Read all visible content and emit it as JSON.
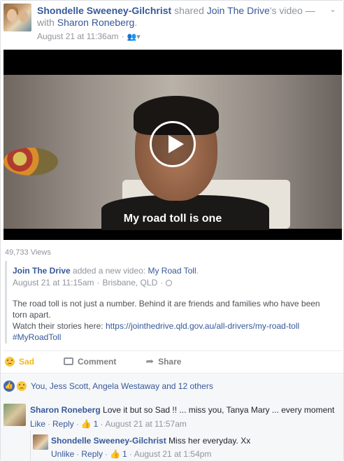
{
  "post": {
    "author": "Shondelle Sweeney-Gilchrist",
    "shared_text": "shared",
    "page_name": "Join The Drive",
    "video_suffix": "'s video —",
    "with_text": "with",
    "tagged": "Sharon Roneberg",
    "tagged_suffix": ".",
    "timestamp": "August 21 at 11:36am",
    "audience_icon": "friends-icon"
  },
  "video": {
    "caption": "My road toll is one",
    "views": "49,733 Views"
  },
  "shared": {
    "page_name": "Join The Drive",
    "added_text": "added a new video:",
    "video_title": "My Road Toll",
    "video_title_suffix": ".",
    "timestamp": "August 21 at 11:15am",
    "location": "Brisbane, QLD",
    "desc_line1": "The road toll is not just a number. Behind it are friends and families who have been torn apart.",
    "desc_line2_prefix": "Watch their stories here: ",
    "desc_link": "https://jointhedrive.qld.gov.au/all-drivers/my-road-toll",
    "hashtag": "#MyRoadToll"
  },
  "actions": {
    "sad_label": "Sad",
    "comment_label": "Comment",
    "share_label": "Share"
  },
  "reactions": {
    "summary": "You, Jess Scott, Angela Westaway and 12 others"
  },
  "comments": [
    {
      "author": "Sharon Roneberg",
      "text": "Love it but so Sad !! ... miss you, Tanya Mary ... every moment",
      "action1": "Like",
      "action2": "Reply",
      "likes": "1",
      "time": "August 21 at 11:57am"
    },
    {
      "author": "Shondelle Sweeney-Gilchrist",
      "text": "Miss her everyday. Xx",
      "action1": "Unlike",
      "action2": "Reply",
      "likes": "1",
      "time": "August 21 at 1:54pm"
    }
  ],
  "separators": {
    "dot": "·"
  },
  "colors": {
    "link": "#365899",
    "meta": "#90949c",
    "sad": "#f0ba15",
    "like": "#4267b2"
  }
}
